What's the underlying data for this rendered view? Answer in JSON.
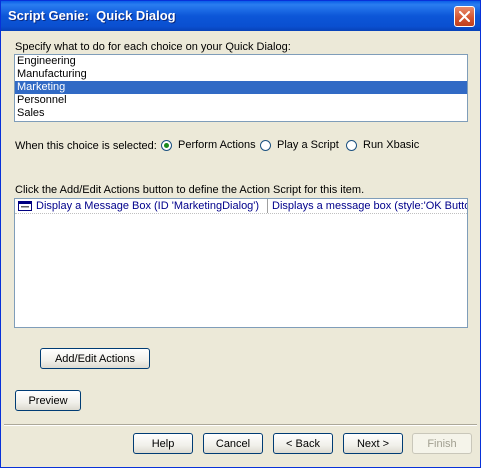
{
  "window": {
    "title": "Script Genie:  Quick Dialog"
  },
  "choices": {
    "label": "Specify what to do for each choice on your Quick Dialog:",
    "items": [
      "Engineering",
      "Manufacturing",
      "Marketing",
      "Personnel",
      "Sales"
    ],
    "selected_index": 2
  },
  "mode": {
    "label": "When this choice is selected:",
    "options": [
      "Perform Actions",
      "Play a Script",
      "Run Xbasic"
    ],
    "selected_index": 0
  },
  "actions": {
    "label": "Click the Add/Edit Actions button to define the Action Script for this item.",
    "rows": [
      {
        "name": "Display a Message Box (ID 'MarketingDialog')",
        "description": "Displays a message box (style:'OK Button"
      }
    ]
  },
  "buttons": {
    "add_edit": "Add/Edit Actions",
    "preview": "Preview",
    "help": "Help",
    "cancel": "Cancel",
    "back": "< Back",
    "next": "Next >",
    "finish": "Finish"
  },
  "colors": {
    "selection": "#316ac5",
    "titlebar": "#0a5ee8",
    "dialog_bg": "#ece9d8"
  }
}
